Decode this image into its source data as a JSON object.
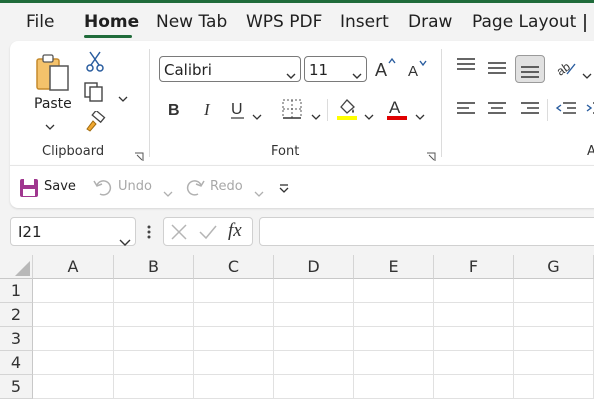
{
  "menu": {
    "tabs": [
      {
        "label": "File"
      },
      {
        "label": "Home"
      },
      {
        "label": "New Tab"
      },
      {
        "label": "WPS PDF"
      },
      {
        "label": "Insert"
      },
      {
        "label": "Draw"
      },
      {
        "label": "Page Layout"
      }
    ],
    "active_tab": "Home",
    "accent_color": "#1f6b3a"
  },
  "ribbon": {
    "clipboard": {
      "paste_label": "Paste",
      "group_label": "Clipboard"
    },
    "font": {
      "font_name": "Calibri",
      "font_size": "11",
      "group_label": "Font",
      "highlight_color": "#ffff00",
      "font_color": "#e00000"
    },
    "alignment": {
      "group_label_partial": "A"
    }
  },
  "qat": {
    "save_label": "Save",
    "undo_label": "Undo",
    "redo_label": "Redo"
  },
  "formula_bar": {
    "name_box": "I21",
    "fx_label": "fx",
    "formula": ""
  },
  "sheet": {
    "columns": [
      "A",
      "B",
      "C",
      "D",
      "E",
      "F",
      "G"
    ],
    "rows": [
      "1",
      "2",
      "3",
      "4",
      "5"
    ]
  }
}
